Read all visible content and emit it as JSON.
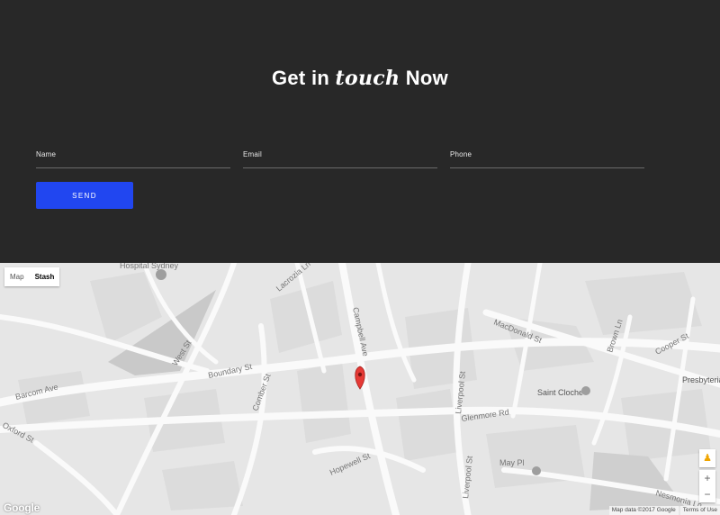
{
  "contact": {
    "heading_pre": "Get in",
    "heading_em": "touch",
    "heading_post": "Now",
    "fields": [
      {
        "label": "Name",
        "value": ""
      },
      {
        "label": "Email",
        "value": ""
      },
      {
        "label": "Phone",
        "value": ""
      }
    ],
    "send_label": "SEND",
    "colors": {
      "background": "#282828",
      "accent": "#2146f0"
    }
  },
  "map": {
    "map_type": {
      "options": [
        "Map",
        "Stash"
      ],
      "selected": "Stash"
    },
    "logo": "Google",
    "attribution": [
      "Map data ©2017 Google",
      "Terms of Use"
    ],
    "zoom_in": "+",
    "zoom_out": "−",
    "marker_color": "#e53935",
    "street_labels": [
      "Hospital Sydney",
      "Barcom Ave",
      "Boundary St",
      "Campbell Ave",
      "Lacrozia Ln",
      "Liverpool St",
      "MacDonald St",
      "Brown Ln",
      "Cooper St",
      "Presbyteria",
      "Saint Cloche",
      "Glenmore Rd",
      "Hopewell St",
      "Oxford St",
      "Comber St",
      "West St",
      "May Pl",
      "Liverpool St",
      "Nesmonia Ln"
    ]
  }
}
